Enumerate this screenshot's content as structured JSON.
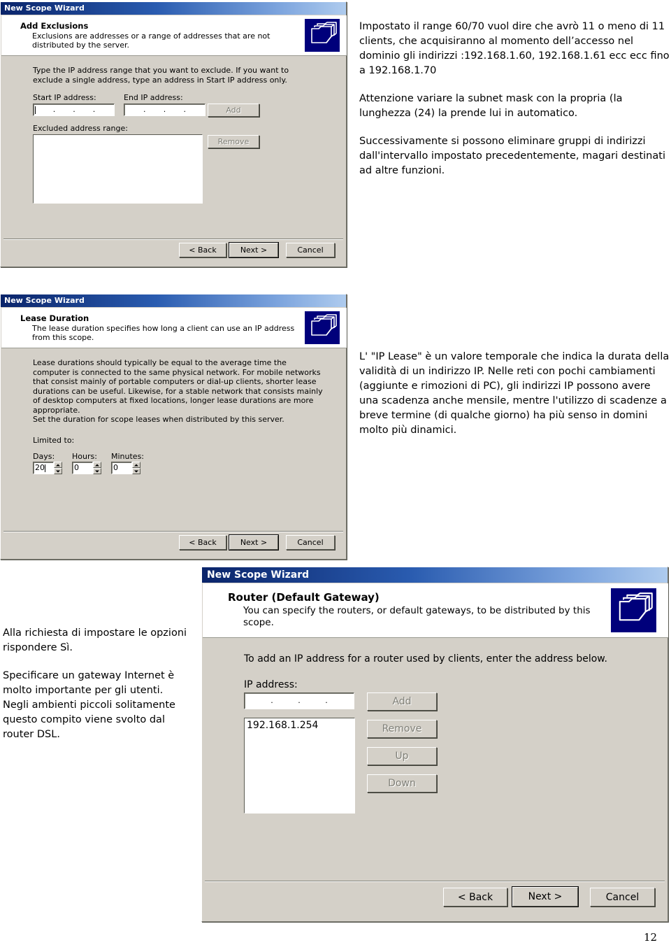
{
  "page": {
    "number": "12"
  },
  "dialogs": [
    {
      "titlebar": "New Scope Wizard",
      "header_title": "Add Exclusions",
      "header_subtitle": "Exclusions are addresses or a range of addresses that are not distributed by the server.",
      "icon": "folders-icon",
      "instruction": "Type the IP address range that you want to exclude. If you want to exclude a single address, type an address in Start IP address only.",
      "start_ip_label": "Start IP address:",
      "end_ip_label": "End IP address:",
      "start_ip_value": "",
      "end_ip_value": "",
      "add_label": "Add",
      "excluded_label": "Excluded address range:",
      "excluded_items": [],
      "remove_label": "Remove",
      "back_label": "< Back",
      "next_label": "Next >",
      "cancel_label": "Cancel"
    },
    {
      "titlebar": "New Scope Wizard",
      "header_title": "Lease Duration",
      "header_subtitle": "The lease duration specifies how long a client can use an IP address from this scope.",
      "icon": "folders-icon",
      "paragraph1": "Lease durations should typically be equal to the average time the computer is connected to the same physical network. For mobile networks that consist mainly of portable computers or dial-up clients, shorter lease durations can be useful. Likewise, for a stable network that consists mainly of desktop computers at fixed locations, longer lease durations are more appropriate.",
      "paragraph2": "Set the duration for scope leases when distributed by this server.",
      "limited_label": "Limited to:",
      "days_label": "Days:",
      "days_value": "20",
      "hours_label": "Hours:",
      "hours_value": "0",
      "minutes_label": "Minutes:",
      "minutes_value": "0",
      "back_label": "< Back",
      "next_label": "Next >",
      "cancel_label": "Cancel"
    },
    {
      "titlebar": "New Scope Wizard",
      "header_title": "Router (Default Gateway)",
      "header_subtitle": "You can specify the routers, or default gateways, to be distributed by this scope.",
      "icon": "folders-icon",
      "instruction": "To add an IP address for a router used by clients, enter the address below.",
      "ip_label": "IP address:",
      "ip_value": "",
      "router_list": [
        "192.168.1.254"
      ],
      "add_label": "Add",
      "remove_label": "Remove",
      "up_label": "Up",
      "down_label": "Down",
      "back_label": "< Back",
      "next_label": "Next >",
      "cancel_label": "Cancel"
    }
  ],
  "notes": {
    "note1_p1": "Impostato il range 60/70 vuol dire che avrò 11 o meno di 11 clients, che acquisiranno al momento dell’accesso nel dominio gli indirizzi :192.168.1.60, 192.168.1.61 ecc ecc fino a 192.168.1.70",
    "note1_p2": "Attenzione variare la subnet mask con la propria (la lunghezza (24) la prende lui in automatico.",
    "note1_p3": "Successivamente si possono eliminare gruppi di indirizzi dall'intervallo impostato precedentemente, magari destinati ad altre funzioni.",
    "note2_p1": "L' \"IP Lease\" è un valore temporale che indica la durata della validità di un indirizzo IP. Nelle reti con pochi cambiamenti (aggiunte e rimozioni di PC), gli indirizzi IP possono avere una scadenza anche mensile, mentre l'utilizzo di scadenze a breve termine (di qualche giorno) ha più senso in domini molto più dinamici.",
    "note3_p1": "Alla richiesta di impostare le opzioni rispondere Sì.",
    "note3_p2": "Specificare un gateway Internet è molto importante per gli utenti. Negli ambienti piccoli solitamente questo compito viene svolto dal router DSL."
  },
  "colors": {
    "dialog_face": "#d4d0c8",
    "titlebar_start": "#0a246a",
    "titlebar_end": "#aecbee",
    "icon_navy": "#00007b"
  }
}
